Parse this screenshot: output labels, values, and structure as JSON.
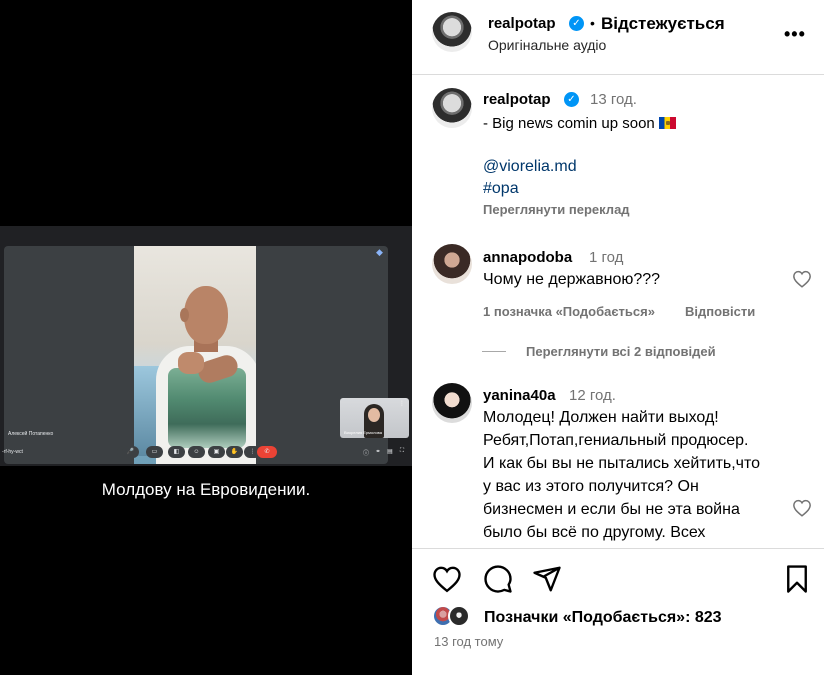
{
  "video": {
    "meeting": {
      "speaker_name": "Алексей Потапенко",
      "pip_name": "Виорелия Ермолова",
      "meeting_code": "-rf-hy-wct",
      "toolbar_glyphs": [
        "⋯",
        "🎤",
        "▭",
        "◧",
        "☺",
        "▣",
        "✋",
        "⋮"
      ],
      "end_glyph": "✆",
      "right_glyphs": [
        "ⓘ",
        "⚭",
        "▤",
        "⛶"
      ]
    },
    "subtitle": "Молдову на Евровидении."
  },
  "header": {
    "username": "realpotap",
    "separator": "•",
    "follow_label": "Відстежується",
    "audio_label": "Оригінальне аудіо",
    "more_label": "•••"
  },
  "caption": {
    "username": "realpotap",
    "time": "13 год.",
    "text": "- Big news comin up soon",
    "mention": "@viorelia.md",
    "hashtag": "#opa",
    "translate": "Переглянути переклад"
  },
  "comments": [
    {
      "username": "annapodoba",
      "time": "1 год",
      "text": "Чому не державною???",
      "likes": "1 позначка «Подобається»",
      "reply": "Відповісти",
      "view_replies": "Переглянути всі 2 відповідей"
    },
    {
      "username": "yanina40a",
      "time": "12 год.",
      "lines": [
        "Молодец! Должен найти выход!",
        "Ребят,Потап,гениальный продюсер.",
        "И как бы вы не пытались хейтить,что",
        "у вас из этого получится? Он",
        "бизнесмен и если бы не эта война",
        "было бы всё по другому. Всех"
      ]
    }
  ],
  "footer": {
    "likes": "Позначки «Подобається»: 823",
    "posted": "13 год тому"
  },
  "colors": {
    "verified": "#0095f6",
    "link": "#00376b",
    "muted": "#737373",
    "end_call": "#ea4335"
  }
}
